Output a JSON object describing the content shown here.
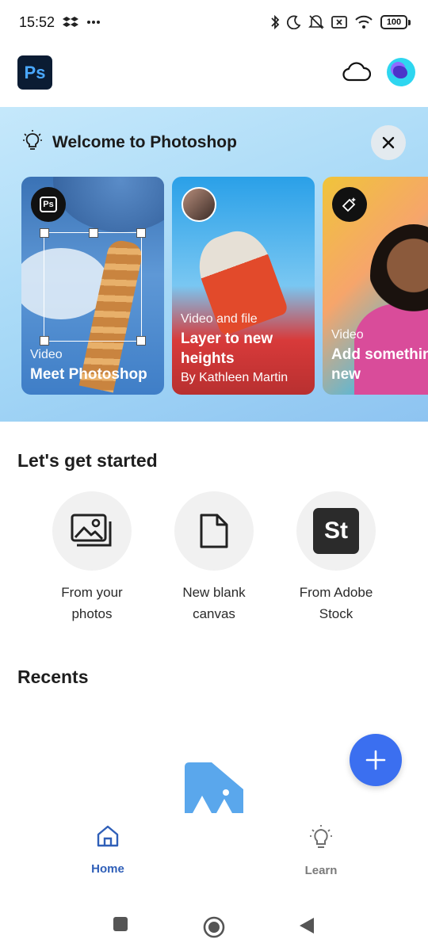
{
  "status_bar": {
    "time": "15:52",
    "battery": "100",
    "icons": [
      "dropbox-icon",
      "more-dots-icon",
      "bluetooth-icon",
      "moon-icon",
      "mute-icon",
      "sim-off-icon",
      "wifi-icon",
      "battery-icon"
    ]
  },
  "header": {
    "app_logo": "Ps",
    "cloud_icon": "cloud-icon",
    "avatar_icon": "profile-avatar"
  },
  "welcome": {
    "title": "Welcome to Photoshop",
    "icon": "lightbulb-icon",
    "close_icon": "close-icon",
    "cards": [
      {
        "type": "Video",
        "title": "Meet Photoshop",
        "author": "",
        "badge": "Ps"
      },
      {
        "type": "Video and file",
        "title": "Layer to new\nheights",
        "author": "By Kathleen Martin",
        "badge": "author-photo"
      },
      {
        "type": "Video",
        "title": "Add somethin\nnew",
        "author": "",
        "badge": "magic-eraser-icon"
      }
    ]
  },
  "get_started": {
    "title": "Let's get started",
    "items": [
      {
        "label": "From your photos",
        "icon": "photos-icon"
      },
      {
        "label": "New blank canvas",
        "icon": "blank-document-icon"
      },
      {
        "label": "From Adobe Stock",
        "icon": "St"
      }
    ]
  },
  "recents": {
    "title": "Recents"
  },
  "fab": {
    "icon": "plus-icon"
  },
  "bottom_nav": {
    "items": [
      {
        "label": "Home",
        "icon": "home-icon",
        "active": true
      },
      {
        "label": "Learn",
        "icon": "lightbulb-icon",
        "active": false
      }
    ]
  },
  "colors": {
    "accent": "#3b6ff0",
    "nav_active": "#2f5fb8",
    "welcome_bg": "#a4d7f6",
    "ps_logo_bg": "#0b1c33"
  }
}
